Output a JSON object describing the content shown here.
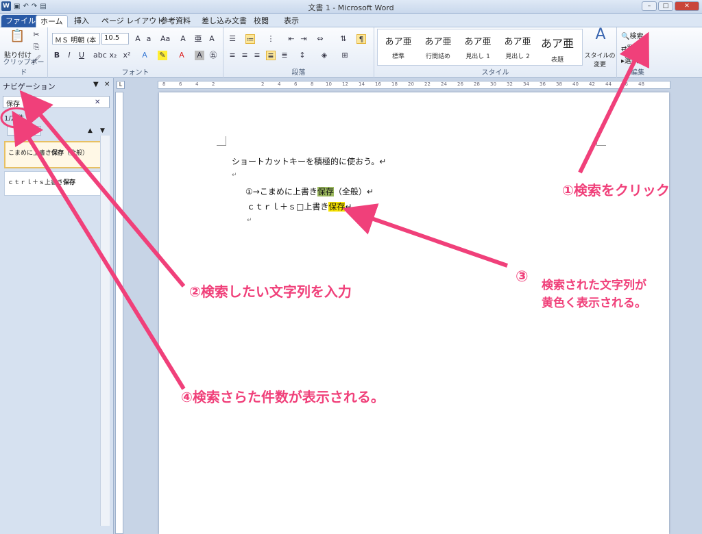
{
  "window": {
    "title": "文書 1 - Microsoft Word"
  },
  "tabs": [
    "ファイル",
    "ホーム",
    "挿入",
    "ページ レイアウト",
    "参考資料",
    "差し込み文書",
    "校閲",
    "表示"
  ],
  "ribbon": {
    "clipboard": {
      "paste": "貼り付け",
      "label": "クリップボード"
    },
    "font": {
      "name": "ＭＳ 明朝 (本",
      "size": "10.5",
      "label": "フォント"
    },
    "paragraph": {
      "label": "段落"
    },
    "styles": {
      "items": [
        {
          "preview": "あア亜",
          "name": "標準"
        },
        {
          "preview": "あア亜",
          "name": "行間詰め"
        },
        {
          "preview": "あア亜",
          "name": "見出し 1"
        },
        {
          "preview": "あア亜",
          "name": "見出し 2"
        },
        {
          "preview": "あア亜",
          "name": "表題"
        }
      ],
      "change": "スタイルの変更",
      "label": "スタイル"
    },
    "editing": {
      "find": "検索",
      "replace": "置換",
      "select": "選択",
      "label": "編集"
    }
  },
  "navigation": {
    "title": "ナビゲーション",
    "search_value": "保存",
    "count": "1/2 件",
    "results": [
      {
        "before": "こまめに上書き",
        "match": "保存",
        "after": "（全般）"
      },
      {
        "before": "ｃｔｒｌ＋ｓ上書き",
        "match": "保存",
        "after": ""
      }
    ]
  },
  "ruler": [
    "8",
    "6",
    "4",
    "2",
    "2",
    "4",
    "6",
    "8",
    "10",
    "12",
    "14",
    "16",
    "18",
    "20",
    "22",
    "24",
    "26",
    "28",
    "30",
    "32",
    "34",
    "36",
    "38",
    "40",
    "42",
    "44",
    "46",
    "48"
  ],
  "document": {
    "line1": "ショートカットキーを積極的に使おう。↵",
    "line2": "↵",
    "line3_before": "①→こまめに上書き",
    "line3_match": "保存",
    "line3_after": "（全般）↵",
    "line4_before": "ｃｔｒｌ＋ｓ□上書き",
    "line4_match": "保存",
    "line4_after": "↵",
    "line5": "↵"
  },
  "callouts": {
    "c1": "①検索をクリック",
    "c2": "②検索したい文字列を入力",
    "c3_num": "③",
    "c3_line1": "検索された文字列が",
    "c3_line2": "黄色く表示される。",
    "c4": "④検索さらた件数が表示される。"
  },
  "colors": {
    "callout": "#f0407a",
    "highlight_green": "#9cba5f",
    "highlight_yellow": "#f6e100"
  }
}
